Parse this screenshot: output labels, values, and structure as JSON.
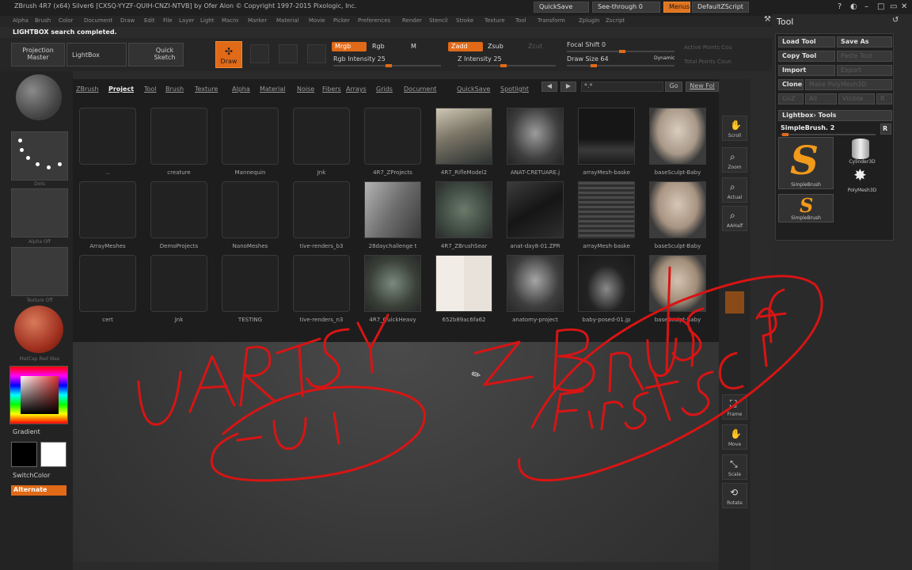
{
  "titlebar": {
    "title": "ZBrush 4R7 (x64) Silver6 [CXSQ-YYZF-QUIH-CNZI-NTVB] by Ofer Alon © Copyright 1997-2015 Pixologic, Inc.",
    "quicksave": "QuickSave",
    "seethrough": "See-through  0",
    "menus": "Menus",
    "default_script": "DefaultZScript"
  },
  "menubar": [
    "Alpha",
    "Brush",
    "Color",
    "Document",
    "Draw",
    "Edit",
    "File",
    "Layer",
    "Light",
    "Macro",
    "Marker",
    "Material",
    "Movie",
    "Picker",
    "Preferences",
    "Render",
    "Stencil",
    "Stroke",
    "Texture",
    "Tool",
    "Transform",
    "Zplugin",
    "Zscript"
  ],
  "status": "LIGHTBOX search completed.",
  "shelf": {
    "projection_master": "Projection Master",
    "lightbox": "LightBox",
    "quick_sketch": "Quick Sketch",
    "draw": "Draw",
    "mrgb": "Mrgb",
    "rgb": "Rgb",
    "m": "M",
    "zadd": "Zadd",
    "zsub": "Zsub",
    "zcut": "Zcut",
    "rgb_intensity": "Rgb Intensity 25",
    "z_intensity": "Z Intensity 25",
    "focal_shift": "Focal Shift 0",
    "draw_size": "Draw Size 64",
    "dynamic": "Dynamic",
    "active_points": "Active Points Cou",
    "total_points": "Total Points Coun"
  },
  "left": {
    "brush_caption": "",
    "stroke_caption": "Dots",
    "alpha_caption": "Alpha Off",
    "texture_caption": "Texture Off",
    "material_caption": "MatCap Red Wax",
    "gradient": "Gradient",
    "switch_color": "SwitchColor",
    "alternate": "Alternate"
  },
  "lightbox": {
    "tabs": [
      "ZBrush",
      "Project",
      "Tool",
      "Brush",
      "Texture",
      "Alpha",
      "Material",
      "Noise",
      "Fibers",
      "Arrays",
      "Grids",
      "Document",
      "QuickSave",
      "Spotlight"
    ],
    "active_tab": "Project",
    "search": "*.*",
    "go": "Go",
    "new_folder": "New Fol",
    "items": [
      {
        "label": "..",
        "kind": "folder"
      },
      {
        "label": "creature",
        "kind": "folder"
      },
      {
        "label": "Mannequin",
        "kind": "folder"
      },
      {
        "label": "Jnk",
        "kind": "folder"
      },
      {
        "label": "4R7_ZProjects",
        "kind": "folder"
      },
      {
        "label": "4R7_RifleModel2",
        "kind": "image"
      },
      {
        "label": "ANAT-CRETUARE.j",
        "kind": "image"
      },
      {
        "label": "arrayMesh-baske",
        "kind": "image"
      },
      {
        "label": "baseSculpt-Baby",
        "kind": "image"
      },
      {
        "label": "ArrayMeshes",
        "kind": "folder"
      },
      {
        "label": "DemoProjects",
        "kind": "folder"
      },
      {
        "label": "NanoMeshes",
        "kind": "folder"
      },
      {
        "label": "tive-renders_b3",
        "kind": "folder"
      },
      {
        "label": "28daychallenge t",
        "kind": "image"
      },
      {
        "label": "4R7_ZBrushSear",
        "kind": "image"
      },
      {
        "label": "anat-day8-01.ZPR",
        "kind": "image"
      },
      {
        "label": "arrayMesh-baske",
        "kind": "image"
      },
      {
        "label": "baseSculpt-Baby",
        "kind": "image"
      },
      {
        "label": "cert",
        "kind": "folder"
      },
      {
        "label": "Jnk",
        "kind": "folder"
      },
      {
        "label": "TESTING",
        "kind": "folder"
      },
      {
        "label": "tive-renders_n3",
        "kind": "folder"
      },
      {
        "label": "4R7_QuickHeavy",
        "kind": "image"
      },
      {
        "label": "652b89ac6fa62",
        "kind": "image"
      },
      {
        "label": "anatomy-project",
        "kind": "image"
      },
      {
        "label": "baby-posed-01.jp",
        "kind": "image"
      },
      {
        "label": "baseSculpt-Baby",
        "kind": "image"
      }
    ]
  },
  "rtools": {
    "scroll": "Scroll",
    "zoom": "Zoom",
    "actual": "Actual",
    "aahalf": "AAHalf",
    "frame": "Frame",
    "move": "Move",
    "scale": "Scale",
    "rotate": "Rotate"
  },
  "tool": {
    "title": "Tool",
    "load_tool": "Load Tool",
    "save_as": "Save As",
    "copy_tool": "Copy Tool",
    "paste_tool": "Paste Tool",
    "import": "Import",
    "export": "Export",
    "clone": "Clone",
    "make_polymesh": "Make PolyMesh3D",
    "goz": "GoZ",
    "all": "All",
    "visible": "Visible",
    "r": "R",
    "lightbox_tools": "Lightbox› Tools",
    "simple_brush": "SimpleBrush. 2",
    "r_btn": "R",
    "thumb1": "SimpleBrush",
    "thumb2": "Cylinder3D",
    "thumb3": "PolyMesh3D",
    "thumb4": "SimpleBrush"
  },
  "annotations": {
    "left_text": "UARTSY",
    "left_circled": "-UI",
    "right_text": "ZBrush",
    "right_circled": "FirstSculpt"
  },
  "colors": {
    "accent": "#e06a18",
    "annotation": "#d81414"
  }
}
